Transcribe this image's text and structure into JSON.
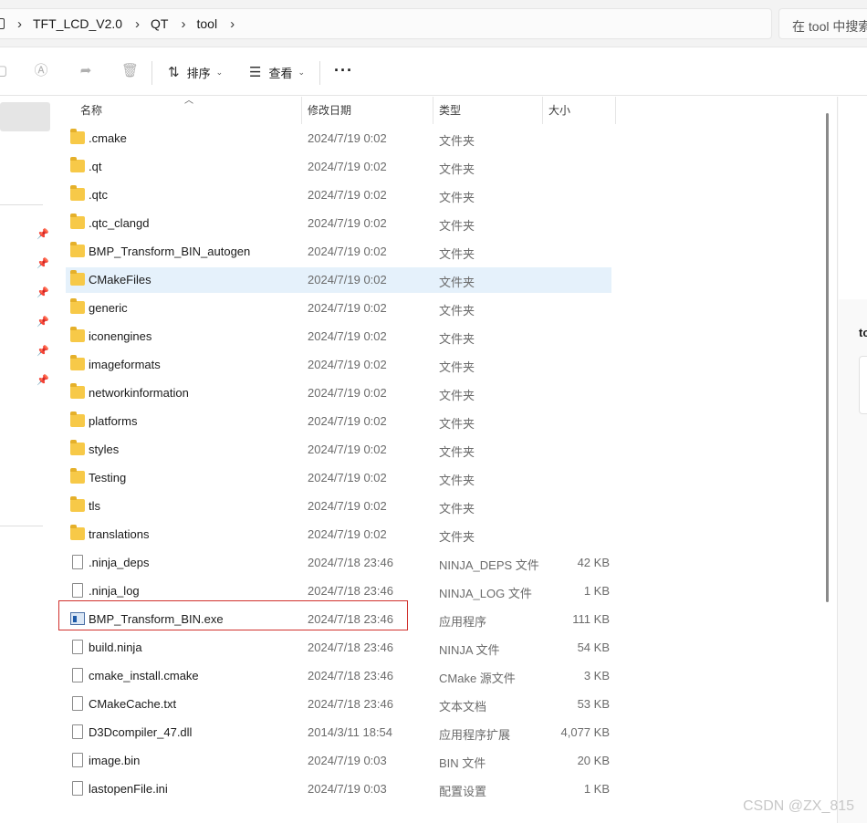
{
  "address": {
    "breadcrumbs": [
      "TFT_LCD_V2.0",
      "QT",
      "tool"
    ],
    "separator": "›",
    "search_placeholder": "在 tool 中搜索"
  },
  "toolbar": {
    "sort_label": "排序",
    "view_label": "查看",
    "more_label": "···"
  },
  "columns": {
    "name": "名称",
    "date": "修改日期",
    "type": "类型",
    "size": "大小"
  },
  "files": [
    {
      "name": ".cmake",
      "date": "2024/7/19 0:02",
      "type": "文件夹",
      "size": "",
      "icon": "folder"
    },
    {
      "name": ".qt",
      "date": "2024/7/19 0:02",
      "type": "文件夹",
      "size": "",
      "icon": "folder"
    },
    {
      "name": ".qtc",
      "date": "2024/7/19 0:02",
      "type": "文件夹",
      "size": "",
      "icon": "folder"
    },
    {
      "name": ".qtc_clangd",
      "date": "2024/7/19 0:02",
      "type": "文件夹",
      "size": "",
      "icon": "folder"
    },
    {
      "name": "BMP_Transform_BIN_autogen",
      "date": "2024/7/19 0:02",
      "type": "文件夹",
      "size": "",
      "icon": "folder"
    },
    {
      "name": "CMakeFiles",
      "date": "2024/7/19 0:02",
      "type": "文件夹",
      "size": "",
      "icon": "folder"
    },
    {
      "name": "generic",
      "date": "2024/7/19 0:02",
      "type": "文件夹",
      "size": "",
      "icon": "folder"
    },
    {
      "name": "iconengines",
      "date": "2024/7/19 0:02",
      "type": "文件夹",
      "size": "",
      "icon": "folder"
    },
    {
      "name": "imageformats",
      "date": "2024/7/19 0:02",
      "type": "文件夹",
      "size": "",
      "icon": "folder"
    },
    {
      "name": "networkinformation",
      "date": "2024/7/19 0:02",
      "type": "文件夹",
      "size": "",
      "icon": "folder"
    },
    {
      "name": "platforms",
      "date": "2024/7/19 0:02",
      "type": "文件夹",
      "size": "",
      "icon": "folder"
    },
    {
      "name": "styles",
      "date": "2024/7/19 0:02",
      "type": "文件夹",
      "size": "",
      "icon": "folder"
    },
    {
      "name": "Testing",
      "date": "2024/7/19 0:02",
      "type": "文件夹",
      "size": "",
      "icon": "folder"
    },
    {
      "name": "tls",
      "date": "2024/7/19 0:02",
      "type": "文件夹",
      "size": "",
      "icon": "folder"
    },
    {
      "name": "translations",
      "date": "2024/7/19 0:02",
      "type": "文件夹",
      "size": "",
      "icon": "folder"
    },
    {
      "name": ".ninja_deps",
      "date": "2024/7/18 23:46",
      "type": "NINJA_DEPS 文件",
      "size": "42 KB",
      "icon": "file"
    },
    {
      "name": ".ninja_log",
      "date": "2024/7/18 23:46",
      "type": "NINJA_LOG 文件",
      "size": "1 KB",
      "icon": "file"
    },
    {
      "name": "BMP_Transform_BIN.exe",
      "date": "2024/7/18 23:46",
      "type": "应用程序",
      "size": "111 KB",
      "icon": "exe"
    },
    {
      "name": "build.ninja",
      "date": "2024/7/18 23:46",
      "type": "NINJA 文件",
      "size": "54 KB",
      "icon": "file"
    },
    {
      "name": "cmake_install.cmake",
      "date": "2024/7/18 23:46",
      "type": "CMake 源文件",
      "size": "3 KB",
      "icon": "file"
    },
    {
      "name": "CMakeCache.txt",
      "date": "2024/7/18 23:46",
      "type": "文本文档",
      "size": "53 KB",
      "icon": "file"
    },
    {
      "name": "D3Dcompiler_47.dll",
      "date": "2014/3/11 18:54",
      "type": "应用程序扩展",
      "size": "4,077 KB",
      "icon": "file"
    },
    {
      "name": "image.bin",
      "date": "2024/7/19 0:03",
      "type": "BIN 文件",
      "size": "20 KB",
      "icon": "file"
    },
    {
      "name": "lastopenFile.ini",
      "date": "2024/7/19 0:03",
      "type": "配置设置",
      "size": "1 KB",
      "icon": "file"
    }
  ],
  "selected_index": 5,
  "highlighted_index": 17,
  "details": {
    "title": "to"
  },
  "watermark": "CSDN @ZX_815",
  "colors": {
    "folder": "#f7c948",
    "selection": "#e5f1fb",
    "highlight_border": "#d0312d"
  }
}
